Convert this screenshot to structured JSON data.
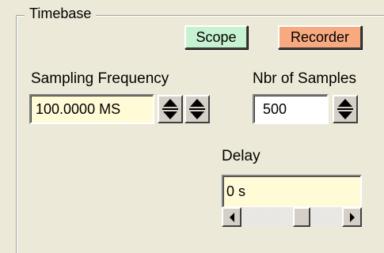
{
  "timebase": {
    "title": "Timebase",
    "scope_label": "Scope",
    "recorder_label": "Recorder",
    "sampling_frequency_label": "Sampling Frequency",
    "sampling_frequency_value": "100.0000 MS",
    "nbr_samples_label": "Nbr of Samples",
    "nbr_samples_value": "500",
    "delay_label": "Delay",
    "delay_value": "0 s"
  },
  "icons": {
    "spin_up": "arrow-up-icon",
    "spin_down": "arrow-down-icon",
    "scroll_left": "arrow-left-icon",
    "scroll_right": "arrow-right-icon"
  },
  "colors": {
    "panel_bg": "#ece9d8",
    "scope_bg": "#c7f2d2",
    "recorder_bg": "#f7a980",
    "yellow_field": "#fffbd6"
  }
}
